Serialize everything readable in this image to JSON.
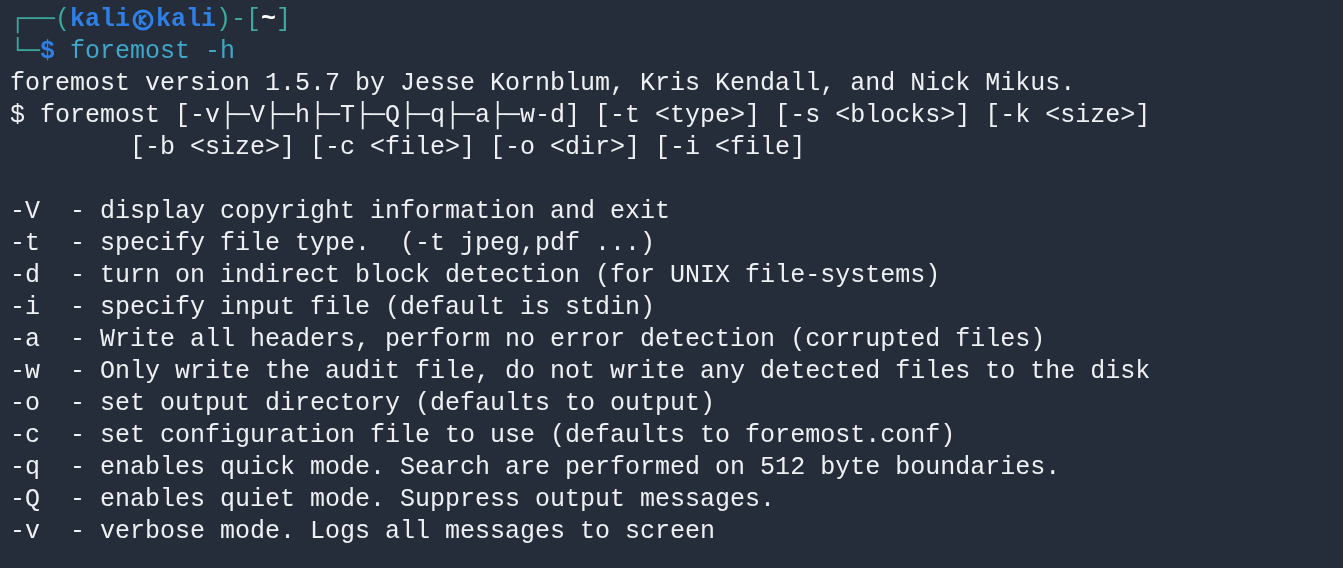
{
  "prompt": {
    "corner_top": "┌──(",
    "user": "kali",
    "host": "kali",
    "close_paren": ")-[",
    "dir": "~",
    "close_bracket": "]",
    "corner_bottom": "└─",
    "symbol": "$",
    "command": " foremost -h"
  },
  "header": [
    "foremost version 1.5.7 by Jesse Kornblum, Kris Kendall, and Nick Mikus.",
    "$ foremost [-v├─V├─h├─T├─Q├─q├─a├─w-d] [-t <type>] [-s <blocks>] [-k <size>]",
    "        [-b <size>] [-c <file>] [-o <dir>] [-i <file]"
  ],
  "options": [
    "-V  - display copyright information and exit",
    "-t  - specify file type.  (-t jpeg,pdf ...)",
    "-d  - turn on indirect block detection (for UNIX file-systems)",
    "-i  - specify input file (default is stdin)",
    "-a  - Write all headers, perform no error detection (corrupted files)",
    "-w  - Only write the audit file, do not write any detected files to the disk",
    "-o  - set output directory (defaults to output)",
    "-c  - set configuration file to use (defaults to foremost.conf)",
    "-q  - enables quick mode. Search are performed on 512 byte boundaries.",
    "-Q  - enables quiet mode. Suppress output messages.",
    "-v  - verbose mode. Logs all messages to screen"
  ]
}
